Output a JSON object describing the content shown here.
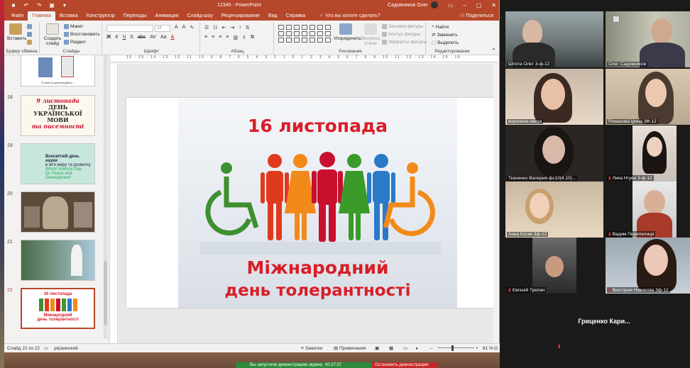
{
  "titlebar": {
    "doc_title": "12345  -  PowerPoint",
    "user": "Садовников Олег",
    "qat": [
      "save-icon",
      "undo-icon",
      "redo-icon",
      "present-icon",
      "more-icon"
    ]
  },
  "tabs": [
    "Файл",
    "Главная",
    "Вставка",
    "Конструктор",
    "Переходы",
    "Анимация",
    "Слайд-шоу",
    "Рецензирование",
    "Вид",
    "Справка"
  ],
  "tell_me": "Что вы хотите сделать?",
  "share": "Поделиться",
  "ribbon": {
    "clipboard": {
      "paste": "Вставить",
      "label": "Буфер обмена"
    },
    "slides": {
      "new_slide": "Создать слайд",
      "layout": "Макет",
      "reset": "Восстановить",
      "section": "Раздел",
      "label": "Слайды"
    },
    "font": {
      "label": "Шрифт",
      "size": "24",
      "buttons": [
        "Ж",
        "К",
        "Ч",
        "S",
        "abc",
        "AV",
        "Аа",
        "А"
      ]
    },
    "paragraph": {
      "label": "Абзац"
    },
    "drawing": {
      "arrange": "Упорядочить",
      "styles": "Экспресс-стили",
      "fill": "Заливка фигуры",
      "outline": "Контур фигуры",
      "effects": "Эффекты фигуры",
      "label": "Рисование"
    },
    "editing": {
      "find": "Найти",
      "replace": "Заменить",
      "select": "Выделить",
      "label": "Редактирование"
    }
  },
  "ruler_text": "16 · 15 · 14 · 13 · 12 · 11 · 10 · 9 · 8 · 7 · 6 · 5 · 4 · 3 · 2 · 1 · 0 · 1 · 2 · 3 · 4 · 5 · 6 · 7 · 8 · 9 · 10 · 11 · 12 · 13 · 14 · 15 · 16",
  "thumbnails": [
    {
      "num": "",
      "caption": "Розвиток цивілізаційної..."
    },
    {
      "num": "18",
      "lines": [
        "9 листопада",
        "ДЕНЬ",
        "УКРАЇНСЬКОЇ",
        "МОВИ",
        "та писемності"
      ]
    },
    {
      "num": "19",
      "lines": [
        "Всесвітній день науки",
        "в ім'я миру та розвитку",
        "World Science Day",
        "for Peace and Development"
      ]
    },
    {
      "num": "20"
    },
    {
      "num": "21"
    },
    {
      "num": "22",
      "lines": [
        "16 листопада",
        "Міжнародний",
        "день толерантності"
      ]
    }
  ],
  "slide": {
    "date": "16 листопада",
    "line1": "Міжнародний",
    "line2": "день толерантності",
    "figure_colors": [
      "#3d8f2f",
      "#e03a1e",
      "#f28a1a",
      "#f2c40f",
      "#c8102e",
      "#3a9a2a",
      "#2a7ac8",
      "#f28a1a"
    ]
  },
  "status": {
    "slide_of": "Слайд 22 из 22",
    "language": "украинский",
    "notes": "Заметки",
    "comments": "Примечания",
    "zoom": "81 %"
  },
  "participants": [
    {
      "name": "Шпота Олег 3-ф-12",
      "speaking": true,
      "mic_off": false
    },
    {
      "name": "Олег Садовников",
      "speaking": false,
      "mic_off": false
    },
    {
      "name": "воронина настя",
      "speaking": false,
      "mic_off": false
    },
    {
      "name": "Романова Ірина 3Ф-12",
      "speaking": false,
      "mic_off": false
    },
    {
      "name": "Ткаченко Валерия фс10(4.10)...",
      "speaking": false,
      "mic_off": false
    },
    {
      "name": "Лика Нгуен 3-ф-12",
      "speaking": false,
      "mic_off": true
    },
    {
      "name": "Анна Косик 3ф-12",
      "speaking": false,
      "mic_off": false
    },
    {
      "name": "Вадим Перепелиця",
      "speaking": false,
      "mic_off": true
    },
    {
      "name": "Євгеній Трепач",
      "speaking": false,
      "mic_off": true
    },
    {
      "name": "Виктория Новикова 3ф-12",
      "speaking": false,
      "mic_off": true
    },
    {
      "name": "Гриценко Кари...",
      "speaking": false,
      "mic_off": true
    }
  ],
  "sharebar": {
    "status": "Вы запустили демонстрацию экрана",
    "timer": "00:27:37",
    "stop": "Остановить демонстрацию"
  }
}
